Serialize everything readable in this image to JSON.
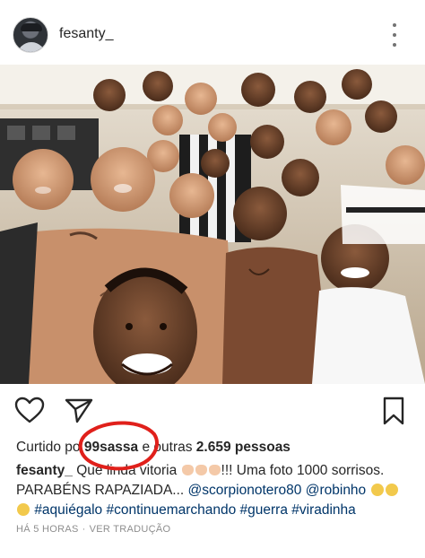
{
  "header": {
    "username": "fesanty_",
    "more_icon": "more-vertical-icon"
  },
  "post": {
    "photo_icon": "team-selfie-photo"
  },
  "actions": {
    "like_icon": "heart-icon",
    "share_icon": "send-icon",
    "save_icon": "bookmark-icon"
  },
  "likes": {
    "prefix": "Curtido po",
    "liker": "99sassa",
    "connector": " e outras ",
    "count": "2.659 pessoas"
  },
  "caption": {
    "user": "fesanty_",
    "text_1": " Que linda vitoria ",
    "text_2": "!!! Uma foto 1000 sorrisos. PARABÉNS RAPAZIADA... ",
    "mention_1": "@scorpionotero80",
    "mention_2": "@robinho",
    "hashtags": "#aquiégalo #continuemarchando #guerra #viradinha"
  },
  "meta": {
    "time": "HÁ 5 HORAS",
    "translate": "VER TRADUÇÃO"
  },
  "colors": {
    "annotation": "#e0201b",
    "link": "#003569",
    "meta": "#8e8e8e"
  }
}
